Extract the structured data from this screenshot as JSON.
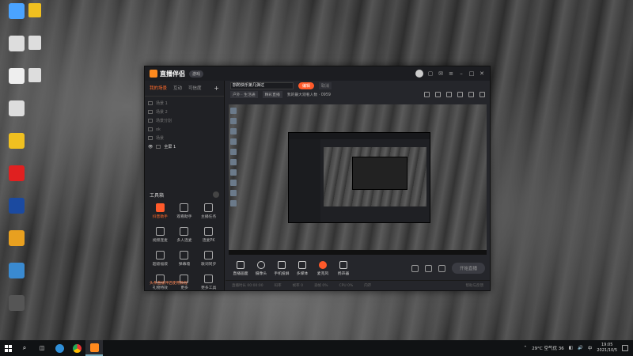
{
  "desktop": {
    "icons": [
      {
        "label": "",
        "color": "#4aa3ff"
      },
      {
        "label": "",
        "color": "#ddd"
      },
      {
        "label": "",
        "color": "#eee"
      },
      {
        "label": "",
        "color": "#ddd"
      },
      {
        "label": "",
        "color": "#f0c020"
      },
      {
        "label": "",
        "color": "#e02020"
      },
      {
        "label": "",
        "color": "#1b4aa0"
      },
      {
        "label": "",
        "color": "#e8a020"
      },
      {
        "label": "",
        "color": "#3a8ad0"
      },
      {
        "label": "",
        "color": "#555"
      }
    ]
  },
  "app": {
    "title": "直播伴侣",
    "title_badge": "游戏",
    "left_tabs": [
      "我的场景",
      "互动",
      "可信度"
    ],
    "active_tab_index": 0,
    "scenes": [
      "场景 1",
      "场景 2",
      "场景分割",
      "ok",
      "场景"
    ],
    "active_scene": "全屏 1",
    "tools_header": "工具箱",
    "tools": [
      {
        "label": "抖音助手",
        "active": true
      },
      {
        "label": "观看助手"
      },
      {
        "label": "主播任务"
      },
      {
        "label": "视频连麦"
      },
      {
        "label": "多人连麦"
      },
      {
        "label": "连麦PK"
      },
      {
        "label": "超级福袋"
      },
      {
        "label": "弹幕墙"
      },
      {
        "label": "歌词同步"
      },
      {
        "label": "礼物特效"
      },
      {
        "label": "更多"
      },
      {
        "label": "更多工具"
      }
    ],
    "promo": "头条直播伴侣使用教程",
    "live_title": "斟酌快乐第几弹过",
    "orange_button": "编辑",
    "top_tag": "取消",
    "sub_chips": [
      "户外 · 生活通",
      "精彩直播"
    ],
    "sub_text": "我的最大观看人数 · 0959",
    "controls": [
      "直播画面",
      "摄像头",
      "手机投屏",
      "多媒体",
      "麦克风",
      "扬声器"
    ],
    "start_button": "开始直播",
    "status": [
      "直播时长 00:00:00",
      "码率",
      "帧率 0",
      "丢帧 0%",
      "CPU 0%",
      "内存"
    ],
    "status_right": "帮助与反馈"
  },
  "taskbar": {
    "weather": "29°C 空气优 36",
    "time": "19:05",
    "date": "2021/10/5"
  }
}
